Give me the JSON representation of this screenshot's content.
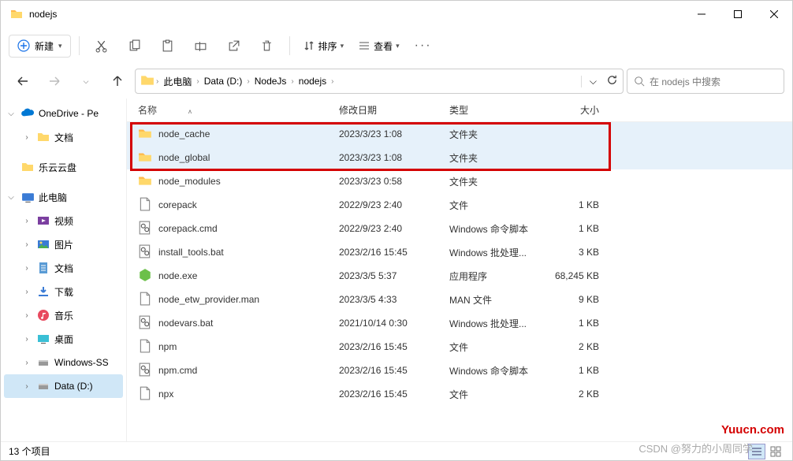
{
  "window": {
    "title": "nodejs"
  },
  "toolbar": {
    "new_label": "新建",
    "sort_label": "排序",
    "view_label": "查看"
  },
  "breadcrumb": {
    "items": [
      "此电脑",
      "Data (D:)",
      "NodeJs",
      "nodejs"
    ]
  },
  "search": {
    "placeholder": "在 nodejs 中搜索"
  },
  "sidebar": {
    "onedrive": "OneDrive - Pe",
    "docs1": "文档",
    "leyun": "乐云云盘",
    "thispc": "此电脑",
    "video": "视频",
    "pictures": "图片",
    "docs2": "文档",
    "downloads": "下载",
    "music": "音乐",
    "desktop": "桌面",
    "winss": "Windows-SS",
    "datad": "Data (D:)"
  },
  "columns": {
    "name": "名称",
    "date": "修改日期",
    "type": "类型",
    "size": "大小"
  },
  "files": [
    {
      "icon": "folder",
      "name": "node_cache",
      "date": "2023/3/23 1:08",
      "type": "文件夹",
      "size": "",
      "hl": true
    },
    {
      "icon": "folder",
      "name": "node_global",
      "date": "2023/3/23 1:08",
      "type": "文件夹",
      "size": "",
      "hl": true
    },
    {
      "icon": "folder",
      "name": "node_modules",
      "date": "2023/3/23 0:58",
      "type": "文件夹",
      "size": ""
    },
    {
      "icon": "file",
      "name": "corepack",
      "date": "2022/9/23 2:40",
      "type": "文件",
      "size": "1 KB"
    },
    {
      "icon": "cmd",
      "name": "corepack.cmd",
      "date": "2022/9/23 2:40",
      "type": "Windows 命令脚本",
      "size": "1 KB"
    },
    {
      "icon": "bat",
      "name": "install_tools.bat",
      "date": "2023/2/16 15:45",
      "type": "Windows 批处理...",
      "size": "3 KB"
    },
    {
      "icon": "exe",
      "name": "node.exe",
      "date": "2023/3/5 5:37",
      "type": "应用程序",
      "size": "68,245 KB"
    },
    {
      "icon": "file",
      "name": "node_etw_provider.man",
      "date": "2023/3/5 4:33",
      "type": "MAN 文件",
      "size": "9 KB"
    },
    {
      "icon": "bat",
      "name": "nodevars.bat",
      "date": "2021/10/14 0:30",
      "type": "Windows 批处理...",
      "size": "1 KB"
    },
    {
      "icon": "file",
      "name": "npm",
      "date": "2023/2/16 15:45",
      "type": "文件",
      "size": "2 KB"
    },
    {
      "icon": "cmd",
      "name": "npm.cmd",
      "date": "2023/2/16 15:45",
      "type": "Windows 命令脚本",
      "size": "1 KB"
    },
    {
      "icon": "file",
      "name": "npx",
      "date": "2023/2/16 15:45",
      "type": "文件",
      "size": "2 KB"
    }
  ],
  "status": {
    "count": "13 个项目"
  },
  "watermark1": "Yuucn.com",
  "watermark2": "CSDN @努力的小周同学"
}
